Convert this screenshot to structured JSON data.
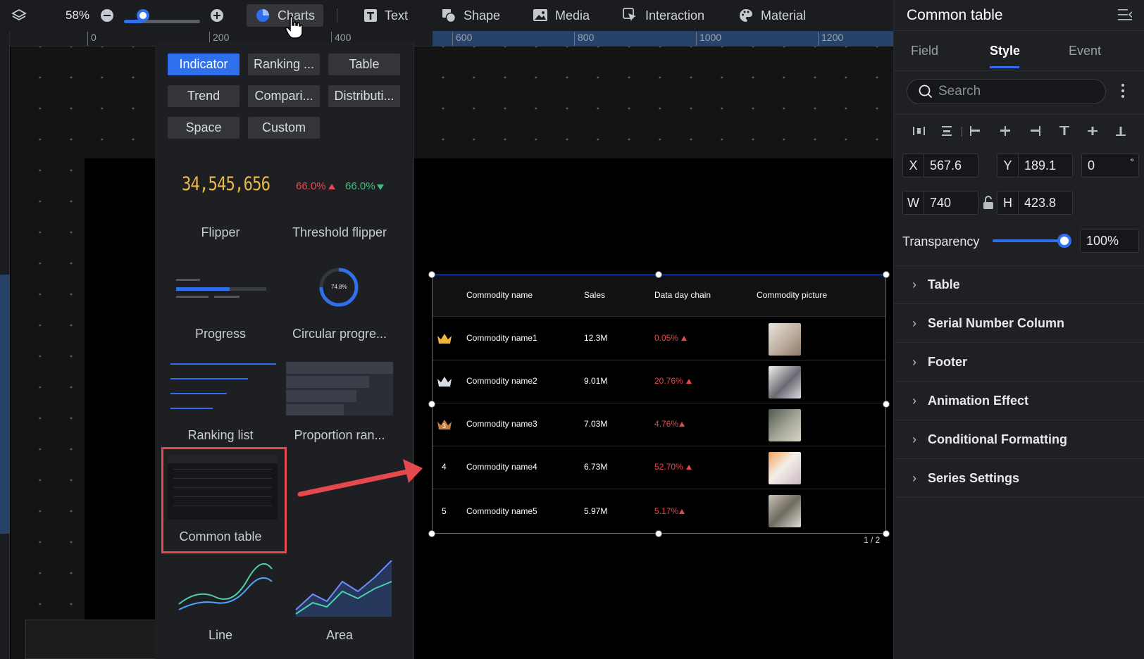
{
  "toolbar": {
    "zoom": "58%",
    "zoom_fraction": 0.25,
    "charts_label": "Charts",
    "text_label": "Text",
    "shape_label": "Shape",
    "media_label": "Media",
    "interaction_label": "Interaction",
    "material_label": "Material"
  },
  "ruler": {
    "ticks": [
      "0",
      "200",
      "400",
      "600",
      "800",
      "1000",
      "1200"
    ]
  },
  "chart_panel": {
    "categories": [
      "Indicator",
      "Ranking ...",
      "Table",
      "Trend",
      "Compari...",
      "Distributi...",
      "Space",
      "Custom"
    ],
    "active_category": "Indicator",
    "flipper_value": "34,545,656",
    "threshold_up": "66.0%",
    "threshold_down": "66.0%",
    "circular_value": "74.8%",
    "items": [
      "Flipper",
      "Threshold flipper",
      "Progress",
      "Circular progre...",
      "Ranking list",
      "Proportion ran...",
      "Common table",
      "Line",
      "Area"
    ]
  },
  "table": {
    "headers": [
      "Commodity name",
      "Sales",
      "Data day chain",
      "Commodity picture"
    ],
    "rows": [
      {
        "rank": "",
        "name": "Commodity name1",
        "sales": "12.3M",
        "chain": "0.05%"
      },
      {
        "rank": "",
        "name": "Commodity name2",
        "sales": "9.01M",
        "chain": "20.76%"
      },
      {
        "rank": "3",
        "name": "Commodity name3",
        "sales": "7.03M",
        "chain": "4.76%"
      },
      {
        "rank": "4",
        "name": "Commodity name4",
        "sales": "6.73M",
        "chain": "52.70%"
      },
      {
        "rank": "5",
        "name": "Commodity name5",
        "sales": "5.97M",
        "chain": "5.17%"
      }
    ],
    "pager": "1 / 2"
  },
  "right_panel": {
    "title": "Common table",
    "tabs": [
      "Field",
      "Style",
      "Event"
    ],
    "active_tab": "Style",
    "search_placeholder": "Search",
    "x_label": "X",
    "x": "567.6",
    "y_label": "Y",
    "y": "189.1",
    "rotation": "0",
    "rotation_unit": "°",
    "w_label": "W",
    "w": "740",
    "h_label": "H",
    "h": "423.8",
    "transparency_label": "Transparency",
    "transparency": "100%",
    "sections": [
      "Table",
      "Serial Number Column",
      "Footer",
      "Animation Effect",
      "Conditional Formatting",
      "Series Settings"
    ]
  },
  "colors": {
    "accent": "#2f6fec",
    "up": "#e5484d",
    "gold": "#e8b84a",
    "highlight": "#e5484d"
  }
}
